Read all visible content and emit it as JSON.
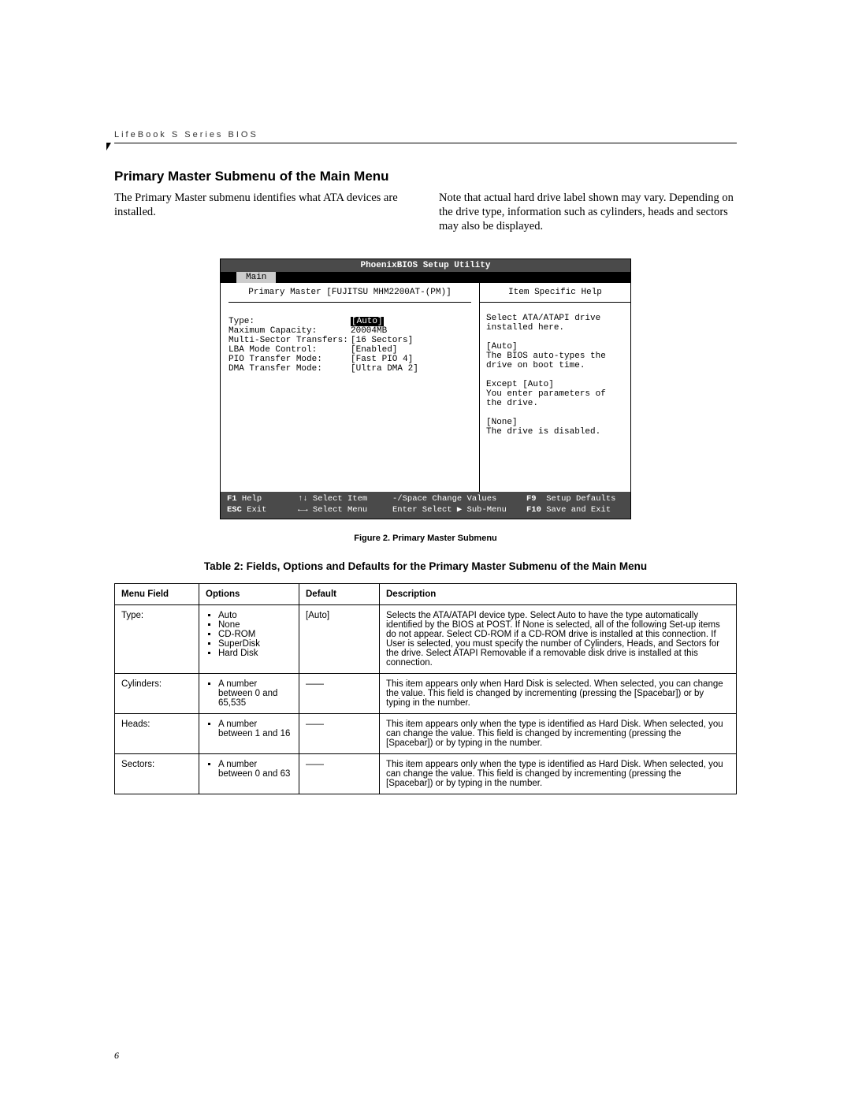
{
  "header": "LifeBook S Series BIOS",
  "section_title": "Primary Master Submenu of the Main Menu",
  "intro_left": "The Primary Master submenu identifies what ATA devices are installed.",
  "intro_right": "Note that actual hard drive label shown may vary. Depending on the drive type, information such as cylinders, heads and sectors may also be displayed.",
  "bios": {
    "utility_title": "PhoenixBIOS Setup Utility",
    "tab": "Main",
    "subtitle": "Primary Master [FUJITSU MHM2200AT-(PM)]",
    "help_title": "Item Specific Help",
    "fields": [
      {
        "label": "Type:",
        "value": "[Auto]",
        "selected": true
      },
      {
        "label": "Maximum Capacity:",
        "value": "20004MB"
      },
      {
        "label": "",
        "value": ""
      },
      {
        "label": "Multi-Sector Transfers:",
        "value": "[16 Sectors]"
      },
      {
        "label": "LBA Mode Control:",
        "value": "[Enabled]"
      },
      {
        "label": "PIO Transfer Mode:",
        "value": "[Fast PIO 4]"
      },
      {
        "label": "DMA Transfer Mode:",
        "value": "[Ultra DMA 2]"
      }
    ],
    "help_lines": [
      "Select ATA/ATAPI drive",
      "installed here.",
      "",
      "[Auto]",
      "The BIOS auto-types the",
      "drive on boot time.",
      "",
      "Except [Auto]",
      "You enter parameters of",
      "the drive.",
      "",
      "[None]",
      "The drive is disabled."
    ],
    "footer": {
      "r1": {
        "c1k": "F1",
        "c1": " Help",
        "c2": "↑↓ Select Item",
        "c3": "-/Space Change Values",
        "c4k": "F9",
        "c4": "  Setup Defaults"
      },
      "r2": {
        "c1k": "ESC",
        "c1": " Exit",
        "c2": "←→ Select Menu",
        "c3": "Enter Select ▶ Sub-Menu",
        "c4k": "F10",
        "c4": " Save and Exit"
      }
    }
  },
  "figure_caption": "Figure 2. Primary Master Submenu",
  "table_caption": "Table 2: Fields, Options and Defaults for the Primary Master Submenu of the Main Menu",
  "table": {
    "headers": [
      "Menu Field",
      "Options",
      "Default",
      "Description"
    ],
    "rows": [
      {
        "field": "Type:",
        "options": [
          "Auto",
          "None",
          "CD-ROM",
          "SuperDisk",
          "Hard Disk"
        ],
        "default": "[Auto]",
        "desc": "Selects the ATA/ATAPI device type. Select Auto to have the type automatically identified by the BIOS at POST. If None is selected, all of the following Set-up items do not appear. Select CD-ROM if a CD-ROM drive is installed at this connection. If User is selected, you must specify the number of Cylinders, Heads, and Sectors for the drive. Select ATAPI Removable if a removable disk drive is installed at this connection."
      },
      {
        "field": "Cylinders:",
        "options": [
          "A number between 0 and 65,535"
        ],
        "default": "——",
        "desc": "This item appears only when Hard Disk is selected. When selected, you can change the value. This field is changed by incrementing (pressing the [Spacebar]) or by typing in the number."
      },
      {
        "field": "Heads:",
        "options": [
          "A number between 1 and 16"
        ],
        "default": "——",
        "desc": "This item appears only when the type is identified as Hard Disk. When selected, you can change the value. This field is changed by incrementing (pressing the [Spacebar]) or by typing in the number."
      },
      {
        "field": "Sectors:",
        "options": [
          "A number between 0 and 63"
        ],
        "default": "——",
        "desc": "This item appears only when the type is identified as Hard Disk. When selected, you can change the value. This field is changed by incrementing (pressing the [Spacebar]) or by typing in the number."
      }
    ]
  },
  "page_number": "6"
}
